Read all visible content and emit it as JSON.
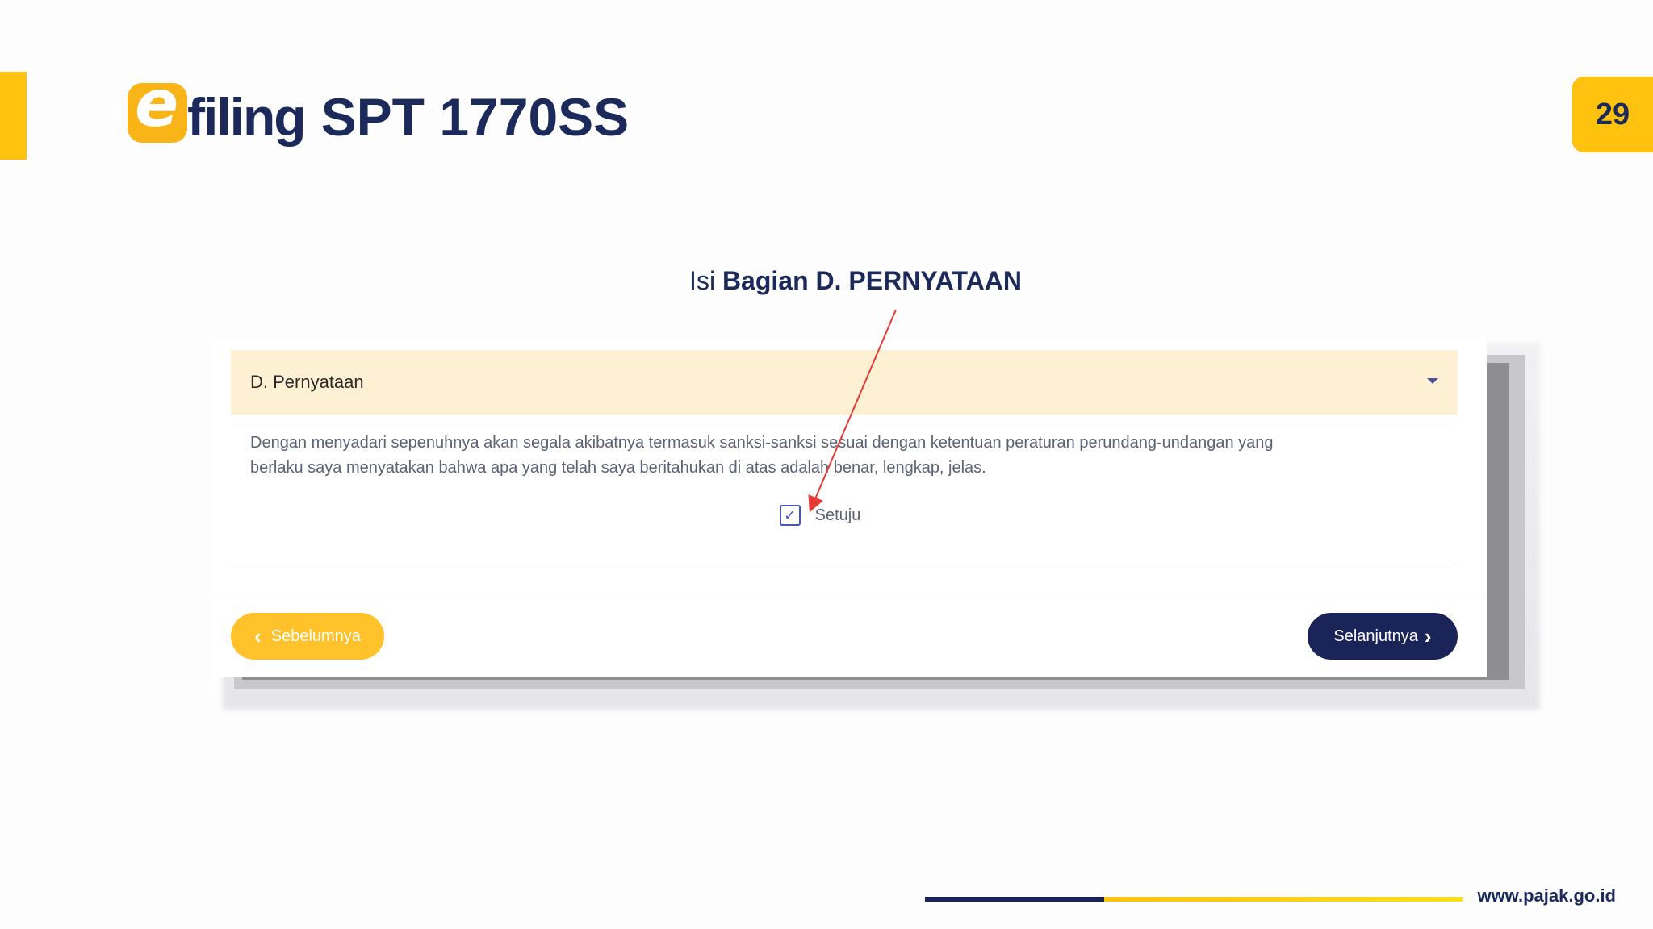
{
  "page": {
    "number": "29"
  },
  "logo": {
    "letter": "e",
    "word": "filing"
  },
  "slide": {
    "title": "SPT 1770SS"
  },
  "instruction": {
    "prefix": "Isi",
    "emphasis": "Bagian D. PERNYATAAN"
  },
  "form": {
    "section_title": "D. Pernyataan",
    "statement_line1": "Dengan menyadari sepenuhnya akan segala akibatnya termasuk sanksi-sanksi sesuai dengan ketentuan peraturan perundang-undangan yang",
    "statement_line2": "berlaku saya menyatakan bahwa apa yang telah saya beritahukan di atas adalah benar, lengkap, jelas.",
    "agree_label": "Setuju",
    "agree_checked": true,
    "prev_label": "Sebelumnya",
    "next_label": "Selanjutnya"
  },
  "footer": {
    "url": "www.pajak.go.id"
  },
  "colors": {
    "brand_yellow": "#FFC20E",
    "brand_navy": "#1B2A5B",
    "annotation_arrow": "#E53935"
  }
}
